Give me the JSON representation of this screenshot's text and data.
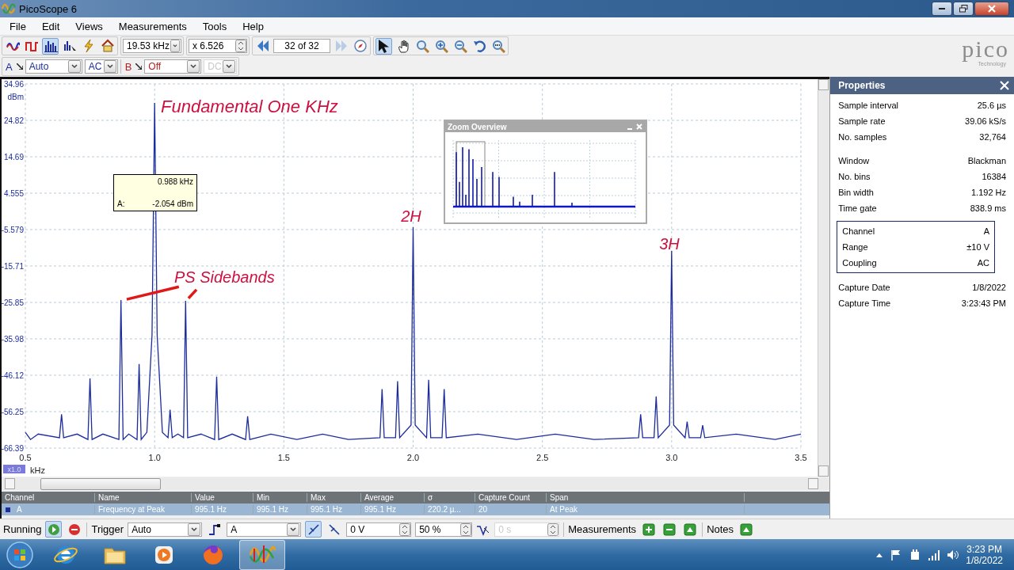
{
  "window": {
    "title": "PicoScope 6"
  },
  "menu": [
    {
      "label": "File"
    },
    {
      "label": "Edit"
    },
    {
      "label": "Views"
    },
    {
      "label": "Measurements"
    },
    {
      "label": "Tools"
    },
    {
      "label": "Help"
    }
  ],
  "toolbar": {
    "modes": [
      {
        "selected": false
      },
      {
        "selected": false
      },
      {
        "selected": true
      },
      {
        "selected": false
      }
    ],
    "timebase": "19.53 kHz",
    "zoom": "x 6.526",
    "buffer": "32 of 32",
    "tools": [
      {
        "selected": true
      },
      {
        "selected": false
      },
      {
        "selected": false
      },
      {
        "selected": false
      },
      {
        "selected": false
      },
      {
        "selected": false
      },
      {
        "selected": false
      }
    ]
  },
  "channels": [
    {
      "name": "A",
      "range": "Auto",
      "coupling": "AC",
      "color": "#1c2c9c",
      "coupling_disabled": false
    },
    {
      "name": "B",
      "range": "Off",
      "coupling": "DC",
      "color": "#b82020",
      "coupling_disabled": true
    }
  ],
  "logo": {
    "name": "pico",
    "tagline": "Technology"
  },
  "spectrum": {
    "chart_data": {
      "type": "line",
      "xlabel": "kHz",
      "ylabel": "dBm",
      "xlim": [
        0.5,
        3.5
      ],
      "ylim": [
        -66.39,
        34.96
      ],
      "xticks": [
        {
          "value": 0.5,
          "label": "0.5"
        },
        {
          "value": 1,
          "label": "1.0"
        },
        {
          "value": 1.5,
          "label": "1.5"
        },
        {
          "value": 2,
          "label": "2.0"
        },
        {
          "value": 2.5,
          "label": "2.5"
        },
        {
          "value": 3,
          "label": "3.0"
        },
        {
          "value": 3.5,
          "label": "3.5"
        }
      ],
      "yticks": [
        {
          "value": 34.96,
          "label": "34.96"
        },
        {
          "value": 24.82,
          "label": "24.82"
        },
        {
          "value": 14.69,
          "label": "14.69"
        },
        {
          "value": 4.555,
          "label": "4.555"
        },
        {
          "value": -5.579,
          "label": "-5.579"
        },
        {
          "value": -15.71,
          "label": "-15.71"
        },
        {
          "value": -25.85,
          "label": "-25.85"
        },
        {
          "value": -35.98,
          "label": "-35.98"
        },
        {
          "value": -46.12,
          "label": "-46.12"
        },
        {
          "value": -56.25,
          "label": "-56.25"
        },
        {
          "value": -66.39,
          "label": "-66.39"
        }
      ],
      "x": [
        0.5,
        0.52,
        0.55,
        0.632,
        0.64,
        0.648,
        0.7,
        0.742,
        0.75,
        0.758,
        0.8,
        0.862,
        0.87,
        0.878,
        0.9,
        0.932,
        0.94,
        0.948,
        0.97,
        0.99,
        1.0,
        1.01,
        1.03,
        1.052,
        1.06,
        1.068,
        1.09,
        1.112,
        1.12,
        1.128,
        1.18,
        1.232,
        1.24,
        1.248,
        1.3,
        1.352,
        1.36,
        1.368,
        1.45,
        1.55,
        1.65,
        1.75,
        1.872,
        1.88,
        1.888,
        1.932,
        1.94,
        1.948,
        1.992,
        2.0,
        2.008,
        2.052,
        2.06,
        2.068,
        2.112,
        2.12,
        2.128,
        2.25,
        2.4,
        2.55,
        2.7,
        2.872,
        2.88,
        2.888,
        2.932,
        2.94,
        2.948,
        2.992,
        3.0,
        3.008,
        3.052,
        3.06,
        3.068,
        3.112,
        3.12,
        3.128,
        3.25,
        3.4,
        3.5
      ],
      "series": [
        {
          "color": "#1c2c9c",
          "values": [
            -62,
            -64,
            -62.5,
            -63.5,
            -57,
            -63.5,
            -62.5,
            -64,
            -47,
            -64,
            -62.5,
            -64,
            -25.2,
            -64,
            -62.5,
            -64,
            -43,
            -64,
            -62,
            -35,
            29.7,
            -35,
            -62,
            -63.5,
            -55.7,
            -63.5,
            -62.5,
            -63.5,
            -25.4,
            -63.5,
            -62.5,
            -64,
            -46.5,
            -64,
            -62.5,
            -64,
            -57.5,
            -64,
            -62.5,
            -64,
            -62.5,
            -64,
            -63.5,
            -50,
            -63.5,
            -63.5,
            -47.8,
            -63.5,
            -60,
            -4.9,
            -60,
            -63.5,
            -47.4,
            -63.5,
            -63.5,
            -50,
            -63.5,
            -62.5,
            -64,
            -62.5,
            -64,
            -63.5,
            -57,
            -63.5,
            -63.5,
            -52,
            -63.5,
            -60,
            -11.5,
            -60,
            -63.5,
            -59,
            -63.5,
            -63.5,
            -60,
            -63.5,
            -62.5,
            -64,
            -62.5
          ]
        }
      ],
      "grid": true,
      "annotations": [
        "Fundamental One KHz",
        "2H",
        "3H",
        "PS Sidebands"
      ]
    },
    "cursor": {
      "frequency": "0.988 kHz",
      "channel": "A:",
      "level": "-2.054 dBm"
    },
    "scale_badge": "x1.0"
  },
  "zoom_overview": {
    "title": "Zoom Overview"
  },
  "properties": {
    "title": "Properties",
    "groups": [
      {
        "boxed": false,
        "rows": [
          {
            "label": "Sample interval",
            "value": "25.6 µs"
          },
          {
            "label": "Sample rate",
            "value": "39.06 kS/s"
          },
          {
            "label": "No. samples",
            "value": "32,764"
          }
        ]
      },
      {
        "boxed": false,
        "rows": [
          {
            "label": "Window",
            "value": "Blackman"
          },
          {
            "label": "No. bins",
            "value": "16384"
          },
          {
            "label": "Bin width",
            "value": "1.192 Hz"
          },
          {
            "label": "Time gate",
            "value": "838.9 ms"
          }
        ]
      },
      {
        "boxed": true,
        "rows": [
          {
            "label": "Channel",
            "value": "A"
          },
          {
            "label": "Range",
            "value": "±10 V"
          },
          {
            "label": "Coupling",
            "value": "AC"
          }
        ]
      },
      {
        "boxed": false,
        "rows": [
          {
            "label": "Capture Date",
            "value": "1/8/2022"
          },
          {
            "label": "Capture Time",
            "value": "3:23:43 PM"
          }
        ]
      }
    ]
  },
  "measurements": {
    "columns": [
      "Channel",
      "Name",
      "Value",
      "Min",
      "Max",
      "Average",
      "σ",
      "Capture Count",
      "Span"
    ],
    "rows": [
      {
        "selected": true,
        "color": "#1c2c9c",
        "cells": [
          "A",
          "Frequency at Peak",
          "995.1 Hz",
          "995.1 Hz",
          "995.1 Hz",
          "995.1 Hz",
          "220.2 µ...",
          "20",
          "At Peak"
        ]
      }
    ]
  },
  "status_bar": {
    "run_state": "Running",
    "running": true,
    "trigger_label": "Trigger",
    "trigger_mode": "Auto",
    "trigger_channel": "A",
    "rising_edge": true,
    "threshold": "0 V",
    "pre_trigger": "50 %",
    "delay": "0 s",
    "measurements_label": "Measurements",
    "notes_label": "Notes"
  },
  "taskbar": {
    "apps": [
      {
        "selected": false
      },
      {
        "selected": false
      },
      {
        "selected": false
      },
      {
        "selected": false
      },
      {
        "selected": true
      }
    ],
    "time": "3:23 PM",
    "date": "1/8/2022"
  }
}
